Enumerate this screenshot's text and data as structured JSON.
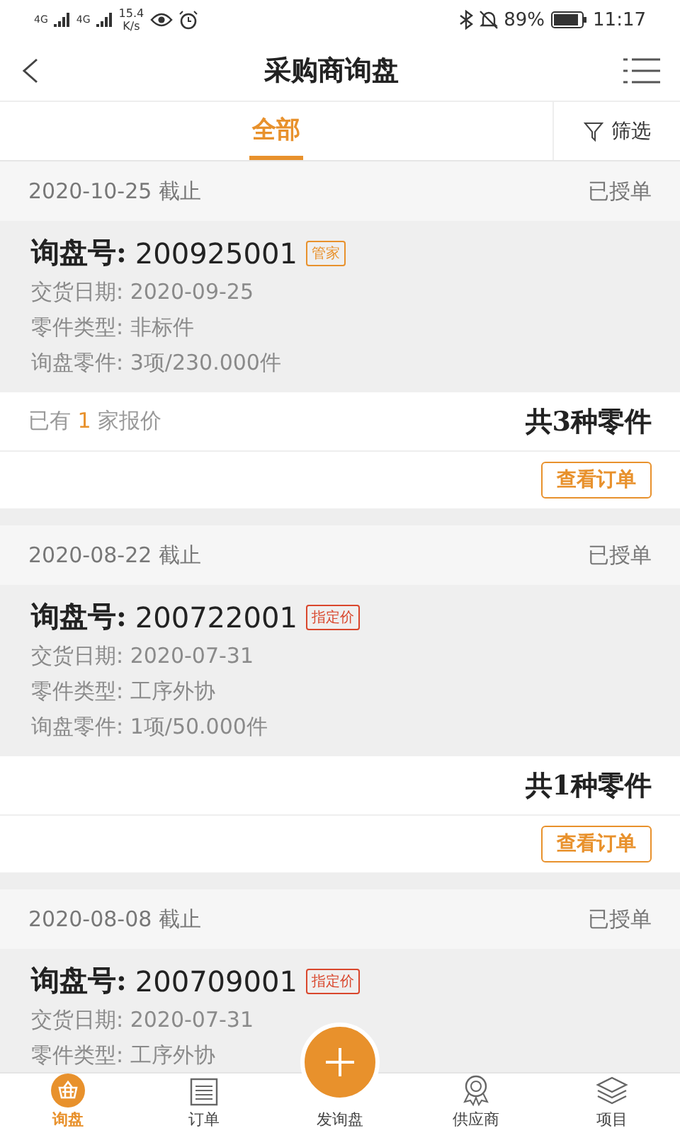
{
  "status_bar": {
    "signal_labels": [
      "4G",
      "4G"
    ],
    "speed": "15.4",
    "speed_unit": "K/s",
    "battery": "89%",
    "time": "11:17"
  },
  "header": {
    "title": "采购商询盘"
  },
  "tabs": [
    {
      "label": "全部",
      "selected": true
    }
  ],
  "filter": {
    "label": "筛选"
  },
  "inquiries": [
    {
      "deadline": "2020-10-25 截止",
      "status": "已授单",
      "number_label": "询盘号:",
      "number": "200925001",
      "badge": {
        "text": "管家",
        "color": "#e8912c"
      },
      "info": [
        {
          "label": "交货日期:",
          "value": "2020-09-25"
        },
        {
          "label": "零件类型:",
          "value": "非标件"
        },
        {
          "label": "询盘零件:",
          "value": "3项/230.000件"
        }
      ],
      "quotes": "已有 **1** 家报价",
      "parts_total": "共3种零件",
      "action": "查看订单"
    },
    {
      "deadline": "2020-08-22 截止",
      "status": "已授单",
      "number_label": "询盘号:",
      "number": "200722001",
      "badge": {
        "text": "指定价",
        "color": "#d9462c"
      },
      "info": [
        {
          "label": "交货日期:",
          "value": "2020-07-31"
        },
        {
          "label": "零件类型:",
          "value": "工序外协"
        },
        {
          "label": "询盘零件:",
          "value": "1项/50.000件"
        }
      ],
      "parts_total": "共1种零件",
      "action": "查看订单"
    },
    {
      "deadline": "2020-08-08 截止",
      "status": "已授单",
      "number_label": "询盘号:",
      "number": "200709001",
      "badge": {
        "text": "指定价",
        "color": "#d9462c"
      },
      "info": [
        {
          "label": "交货日期:",
          "value": "2020-07-31"
        },
        {
          "label": "零件类型:",
          "value": "工序外协"
        }
      ]
    }
  ],
  "nav": [
    {
      "label": "询盘",
      "kind": "basket",
      "selected": true
    },
    {
      "label": "订单",
      "kind": "list",
      "selected": false
    },
    {
      "label": "发询盘",
      "kind": "add",
      "selected": false
    },
    {
      "label": "供应商",
      "kind": "badge",
      "selected": false
    },
    {
      "label": "项目",
      "kind": "layers",
      "selected": false
    }
  ]
}
